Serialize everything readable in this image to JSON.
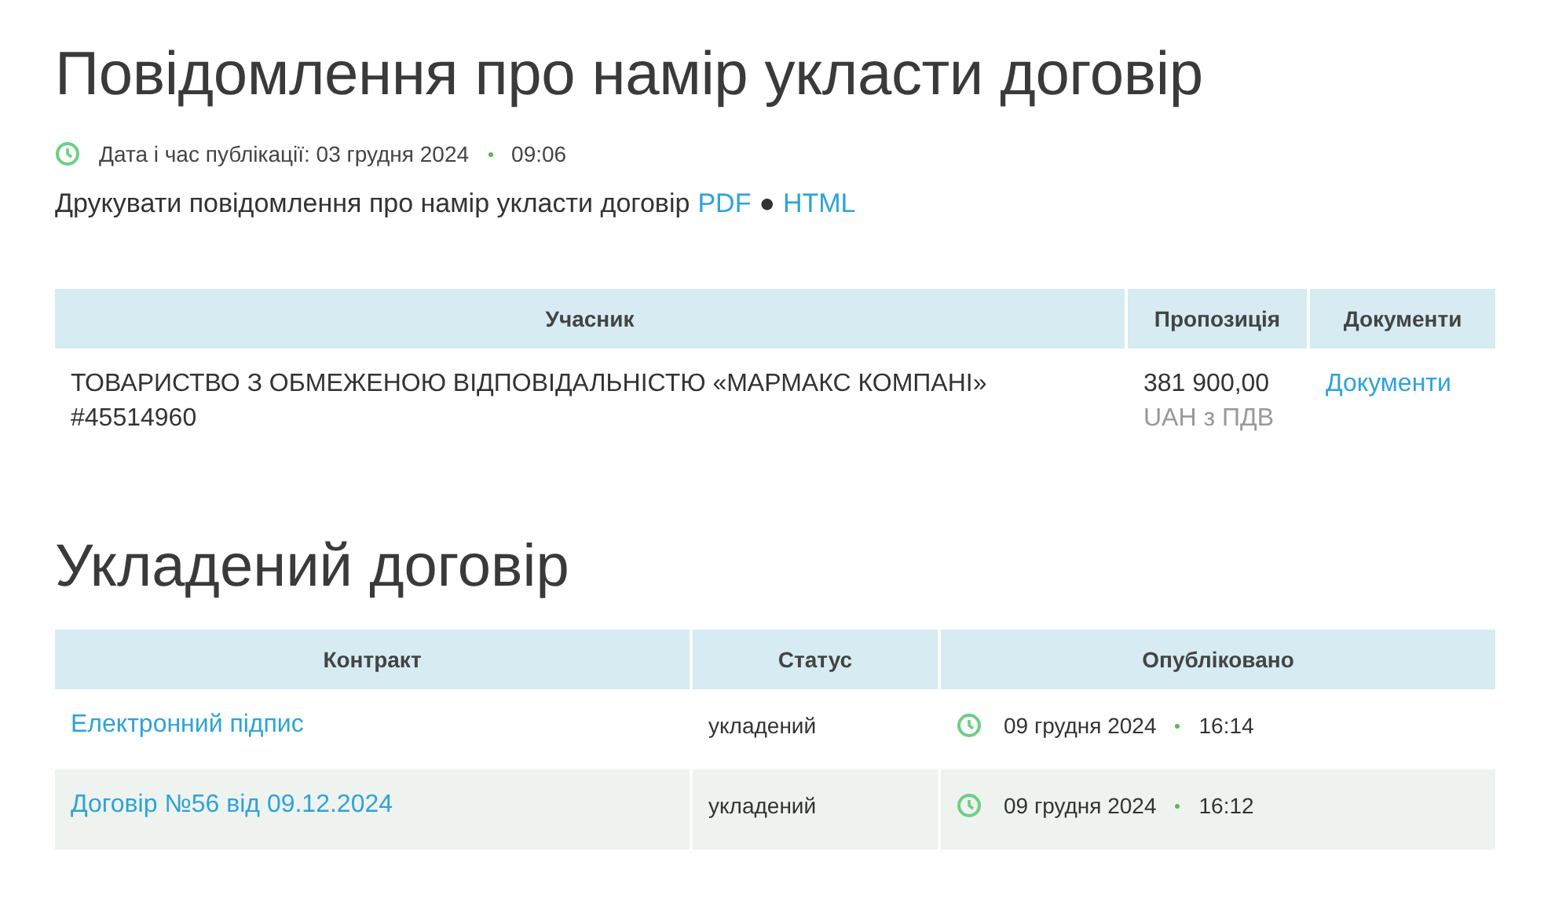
{
  "notice": {
    "title": "Повідомлення про намір укласти договір",
    "published_label": "Дата і час публікації: 03 грудня 2024",
    "published_time": "09:06",
    "print_text": "Друкувати повідомлення про намір укласти договір",
    "print_links": [
      "PDF",
      "HTML"
    ],
    "print_separator": "●"
  },
  "bids_table": {
    "columns": [
      "Учасник",
      "Пропозиція",
      "Документи"
    ],
    "rows": [
      {
        "participant": "ТОВАРИСТВО З ОБМЕЖЕНОЮ ВІДПОВІДАЛЬНІСТЮ «МАРМАКС КОМПАНІ» #45514960",
        "amount": "381 900,00",
        "currency": "UAH з ПДВ",
        "documents": "Документи"
      }
    ]
  },
  "contract": {
    "title": "Укладений договір",
    "columns": [
      "Контракт",
      "Статус",
      "Опубліковано"
    ],
    "rows": [
      {
        "name": "Електронний підпис",
        "status": "укладений",
        "date": "09 грудня 2024",
        "time": "16:14"
      },
      {
        "name": "Договір №56 від 09.12.2024",
        "status": "укладений",
        "date": "09 грудня 2024",
        "time": "16:12"
      }
    ]
  }
}
